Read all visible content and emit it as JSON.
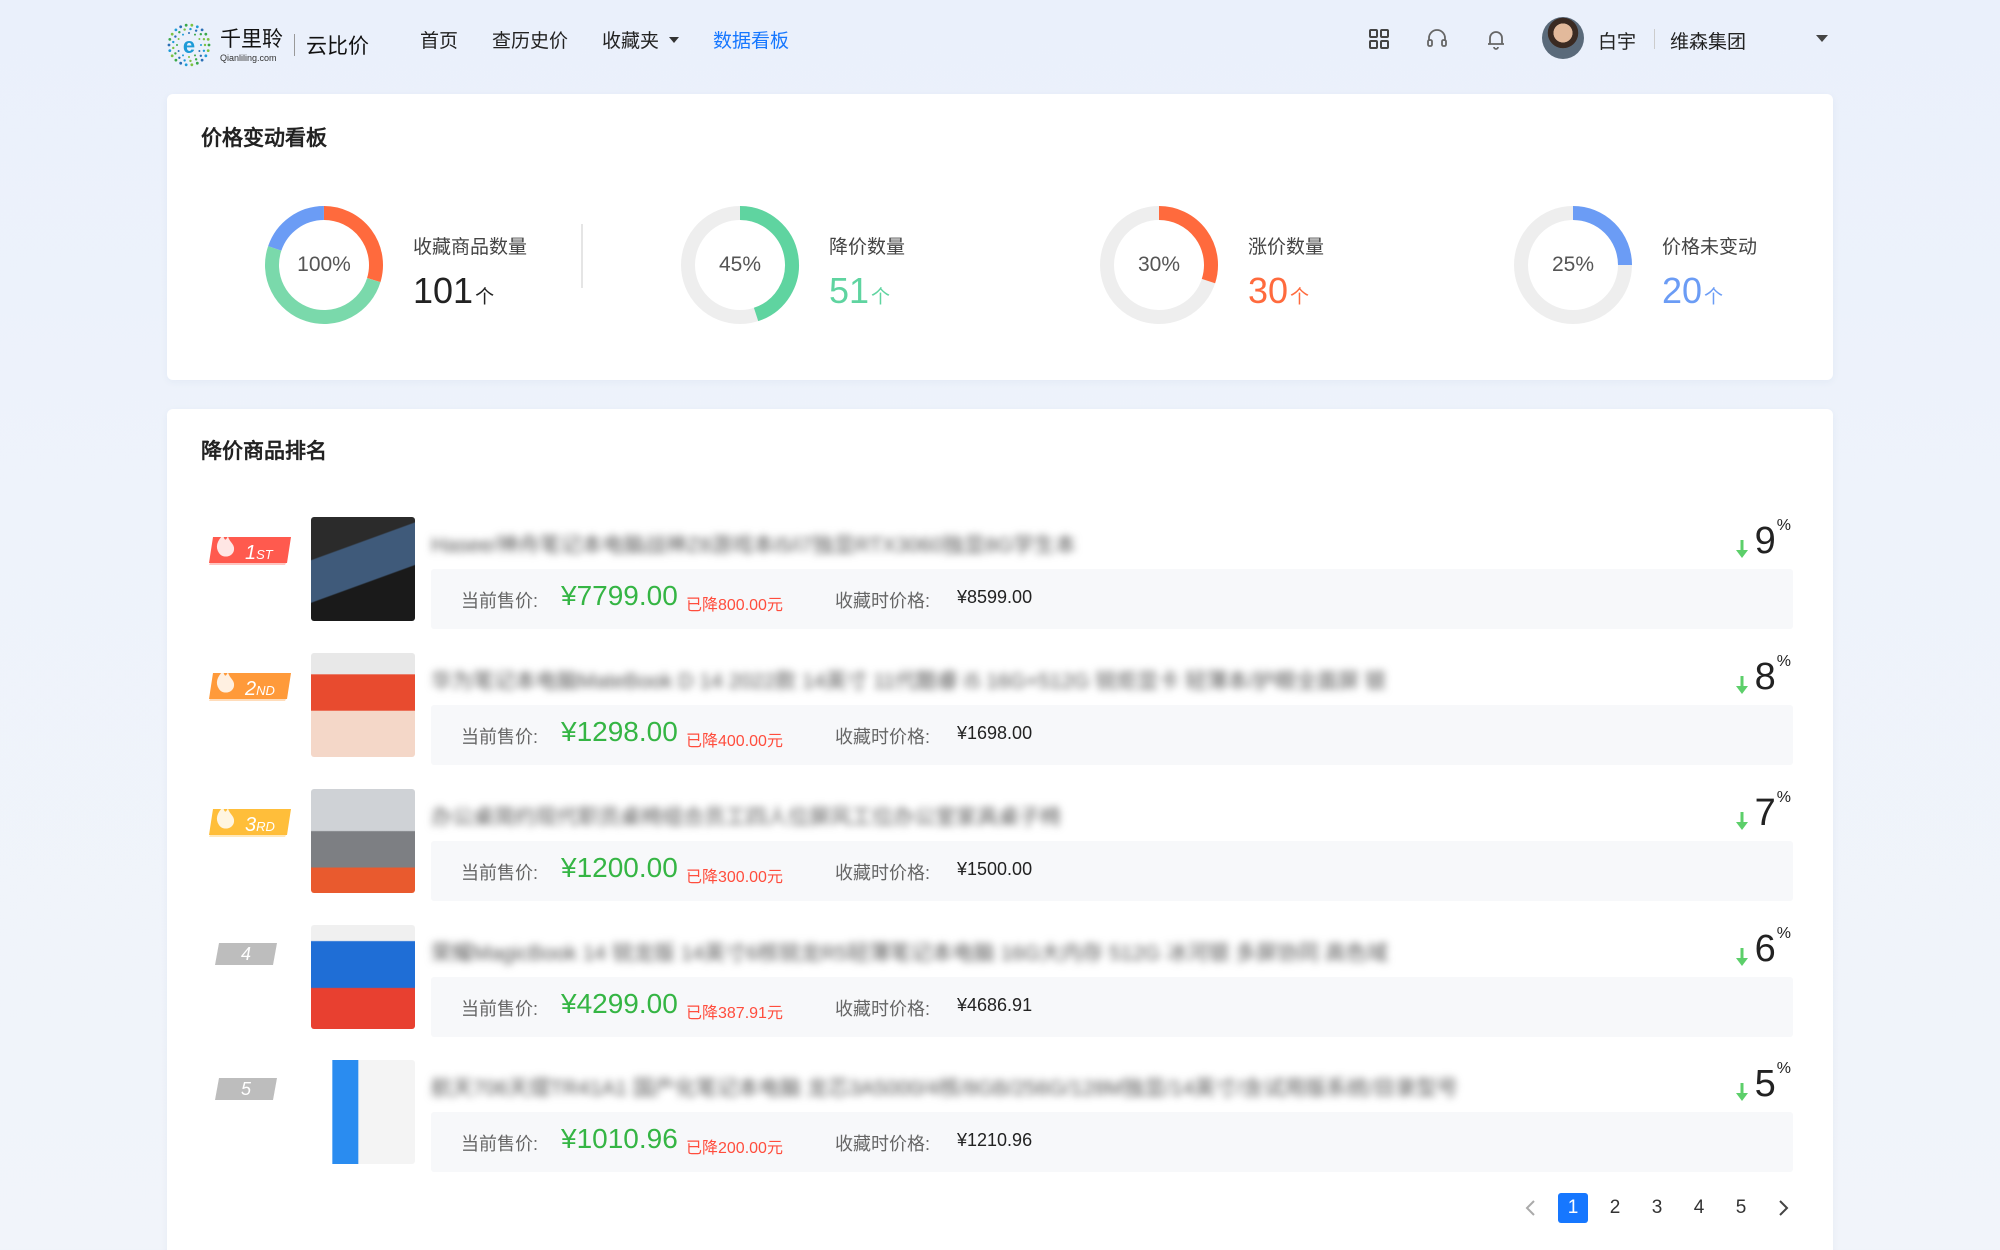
{
  "header": {
    "brand_cn": "千里聆",
    "brand_en": "Qianliling.com",
    "brand_sub": "云比价",
    "nav": [
      {
        "label": "首页"
      },
      {
        "label": "查历史价"
      },
      {
        "label": "收藏夹"
      },
      {
        "label": "数据看板"
      }
    ],
    "active_nav": "数据看板",
    "icons": [
      "apps-grid-icon",
      "headset-icon",
      "bell-icon"
    ],
    "user_name": "白宇",
    "org_name": "维森集团"
  },
  "overview": {
    "title": "价格变动看板",
    "stats": [
      {
        "label": "收藏商品数量",
        "value": "101",
        "unit": "个",
        "percent_text": "100%",
        "color": "#222222"
      },
      {
        "label": "降价数量",
        "value": "51",
        "unit": "个",
        "percent_text": "45%",
        "fraction": 0.45,
        "color": "#5fd4a0"
      },
      {
        "label": "涨价数量",
        "value": "30",
        "unit": "个",
        "percent_text": "30%",
        "fraction": 0.3,
        "color": "#ff6a3d"
      },
      {
        "label": "价格未变动",
        "value": "20",
        "unit": "个",
        "percent_text": "25%",
        "fraction": 0.25,
        "color": "#6b9cf5"
      }
    ],
    "total_ring_segments": [
      {
        "name": "降价",
        "value": 51,
        "color": "#7ad9ab"
      },
      {
        "name": "涨价",
        "value": 30,
        "color": "#ff6a3d"
      },
      {
        "name": "未变动",
        "value": 20,
        "color": "#6b9cf5"
      }
    ],
    "track_color": "#eeeeee"
  },
  "ranking": {
    "title": "降价商品排名",
    "current_label": "当前售价:",
    "fav_label": "收藏时价格:",
    "items": [
      {
        "rank": "1",
        "rank_suffix": "ST",
        "title": "Hasee/神舟笔记本电脑战神Z8游戏本i5/i7独显RTX3060独显8G学生本",
        "current": "¥7799.00",
        "drop": "已降800.00元",
        "fav": "¥8599.00",
        "percent": "9",
        "badge_color": "#ff5a4e"
      },
      {
        "rank": "2",
        "rank_suffix": "ND",
        "title": "华为笔记本电脑MateBook D 14 2022款 14英寸 11代酷睿 i5 16G+512G 锐炬显卡 轻薄本/护眼全面屏 银",
        "current": "¥1298.00",
        "drop": "已降400.00元",
        "fav": "¥1698.00",
        "percent": "8",
        "badge_color": "#ff9a3a"
      },
      {
        "rank": "3",
        "rank_suffix": "RD",
        "title": "办公桌简约现代职员桌椅组合员工四人位屏风工位办公室家具桌子椅",
        "current": "¥1200.00",
        "drop": "已降300.00元",
        "fav": "¥1500.00",
        "percent": "7",
        "badge_color": "#ffbe3a"
      },
      {
        "rank": "4",
        "rank_suffix": "",
        "title": "荣耀MagicBook 14 锐龙版 14英寸6核锐龙R5轻薄笔记本电脑 16G大内存 512G 冰河银 多屏协同 高色域",
        "current": "¥4299.00",
        "drop": "已降387.91元",
        "fav": "¥4686.91",
        "percent": "6",
        "badge_color": "#bdbdbd"
      },
      {
        "rank": "5",
        "rank_suffix": "",
        "title": "航天706天熠TR41A1 国产化笔记本电脑 龙芯3A5000/4核/8GB/256G/128M独显/14英寸/含试用版系统/目录型号",
        "current": "¥1010.96",
        "drop": "已降200.00元",
        "fav": "¥1210.96",
        "percent": "5",
        "badge_color": "#bdbdbd"
      }
    ],
    "percent_sign": "%",
    "drop_color": "#ff4d3d",
    "price_color": "#35b544"
  },
  "pagination": {
    "pages": [
      "1",
      "2",
      "3",
      "4",
      "5"
    ],
    "current": "1"
  }
}
